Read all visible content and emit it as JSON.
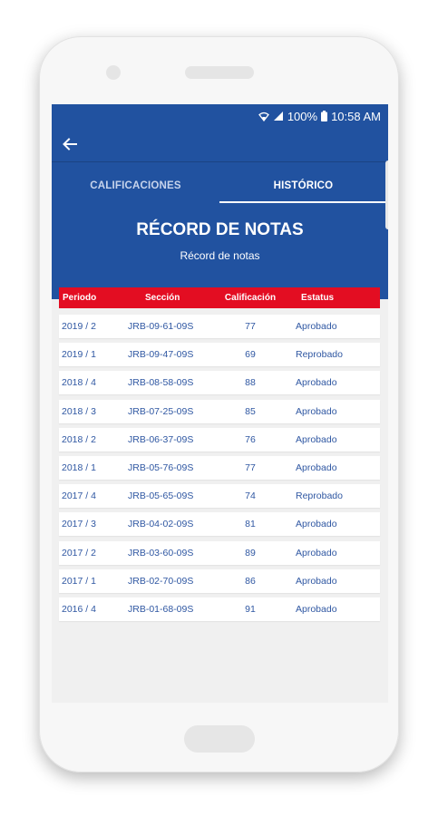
{
  "status": {
    "battery": "100%",
    "time": "10:58 AM"
  },
  "tabs": [
    {
      "label": "CALIFICACIONES",
      "active": false
    },
    {
      "label": "HISTÓRICO",
      "active": true
    }
  ],
  "header": {
    "title": "RÉCORD DE NOTAS",
    "subtitle": "Récord de notas"
  },
  "table": {
    "columns": [
      "Periodo",
      "Sección",
      "Calificación",
      "Estatus"
    ],
    "rows": [
      [
        "2019 / 2",
        "JRB-09-61-09S",
        "77",
        "Aprobado"
      ],
      [
        "2019 / 1",
        "JRB-09-47-09S",
        "69",
        "Reprobado"
      ],
      [
        "2018 / 4",
        "JRB-08-58-09S",
        "88",
        "Aprobado"
      ],
      [
        "2018 / 3",
        "JRB-07-25-09S",
        "85",
        "Aprobado"
      ],
      [
        "2018 / 2",
        "JRB-06-37-09S",
        "76",
        "Aprobado"
      ],
      [
        "2018 / 1",
        "JRB-05-76-09S",
        "77",
        "Aprobado"
      ],
      [
        "2017 / 4",
        "JRB-05-65-09S",
        "74",
        "Reprobado"
      ],
      [
        "2017 / 3",
        "JRB-04-02-09S",
        "81",
        "Aprobado"
      ],
      [
        "2017 / 2",
        "JRB-03-60-09S",
        "89",
        "Aprobado"
      ],
      [
        "2017 / 1",
        "JRB-02-70-09S",
        "86",
        "Aprobado"
      ],
      [
        "2016 / 4",
        "JRB-01-68-09S",
        "91",
        "Aprobado"
      ]
    ]
  },
  "colors": {
    "appbar": "#2152a0",
    "table_header": "#e30d22",
    "row_text": "#2f57a2",
    "screen_bg": "#f0f0f0"
  },
  "icons": {
    "back": "arrow-left-icon",
    "wifi": "wifi-icon",
    "signal": "cell-signal-icon",
    "battery": "battery-icon"
  }
}
